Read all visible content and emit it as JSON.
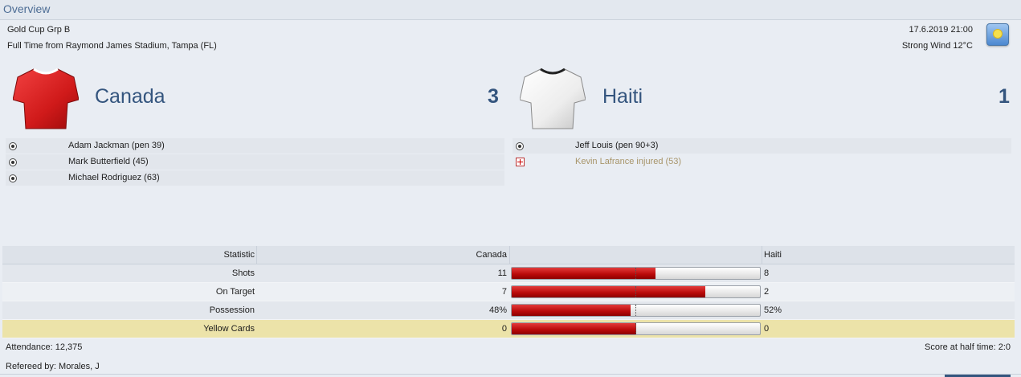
{
  "panel": {
    "title": "Overview"
  },
  "match": {
    "competition": "Gold Cup Grp B",
    "result_line": "Full Time from Raymond James Stadium, Tampa (FL)",
    "datetime": "17.6.2019 21:00",
    "weather_text": "Strong Wind 12°C",
    "weather_icon": "sunny-icon"
  },
  "home": {
    "name": "Canada",
    "score": "3",
    "shirt_color": "#d01a1a",
    "events": [
      {
        "type": "goal",
        "icon": "ball-icon",
        "text": "Adam Jackman (pen 39)"
      },
      {
        "type": "goal",
        "icon": "ball-icon",
        "text": "Mark Butterfield (45)"
      },
      {
        "type": "goal",
        "icon": "ball-icon",
        "text": "Michael Rodriguez (63)"
      }
    ]
  },
  "away": {
    "name": "Haiti",
    "score": "1",
    "shirt_color": "#f2f2f2",
    "events": [
      {
        "type": "goal",
        "icon": "ball-icon",
        "text": "Jeff Louis (pen 90+3)"
      },
      {
        "type": "injury",
        "icon": "injury-icon",
        "text": "Kevin Lafrance injured (53)"
      }
    ]
  },
  "stats": {
    "header": {
      "label": "Statistic",
      "home": "Canada",
      "away": "Haiti"
    },
    "rows": [
      {
        "label": "Shots",
        "home": "11",
        "away": "8",
        "home_share": 0.58
      },
      {
        "label": "On Target",
        "home": "7",
        "away": "2",
        "home_share": 0.78
      },
      {
        "label": "Possession",
        "home": "48%",
        "away": "52%",
        "home_share": 0.48
      },
      {
        "label": "Yellow Cards",
        "home": "0",
        "away": "0",
        "home_share": 0.5
      }
    ]
  },
  "footer": {
    "attendance": "Attendance: 12,375",
    "referee": "Refereed by: Morales, J",
    "halftime": "Score at half time: 2:0"
  },
  "colors": {
    "accent": "#34557e",
    "bar_red": "#c00d0d",
    "highlight_row": "#ece3a9"
  }
}
